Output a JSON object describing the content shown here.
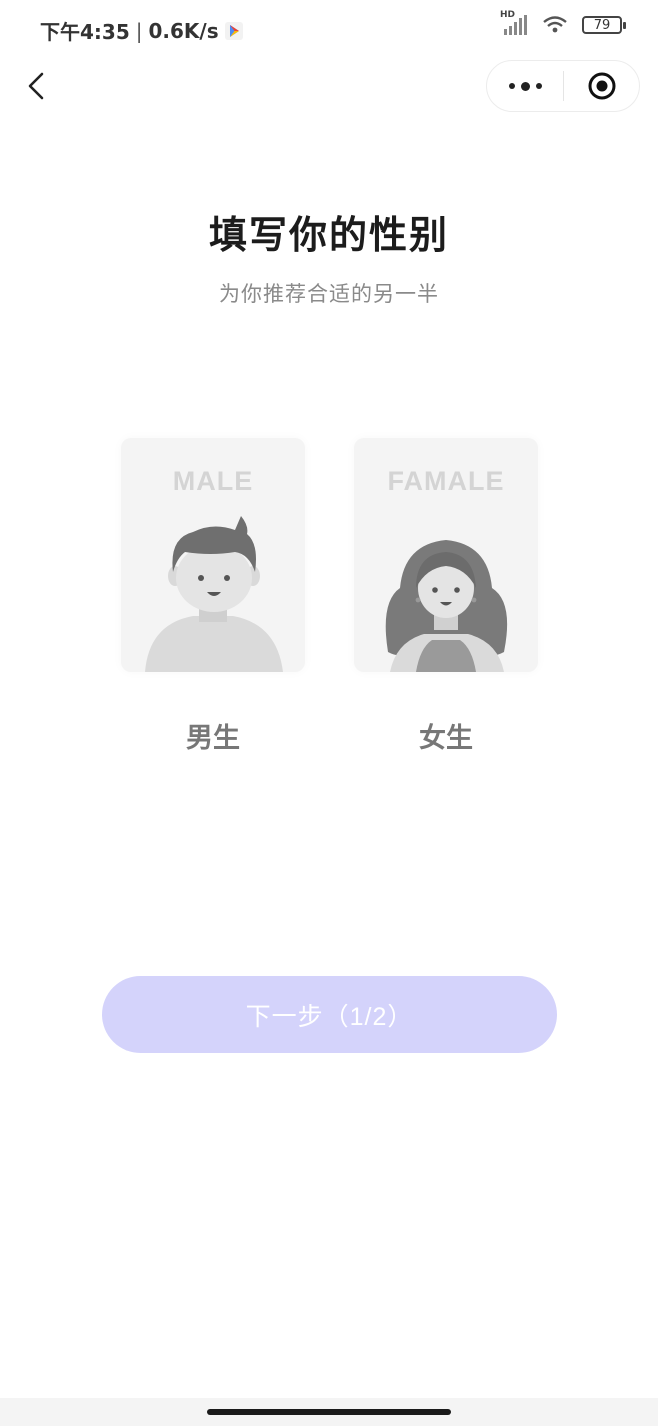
{
  "status_bar": {
    "time": "下午4:35",
    "separator": "|",
    "speed": "0.6K/s",
    "network": "HD",
    "battery": "79"
  },
  "page": {
    "title": "填写你的性别",
    "subtitle": "为你推荐合适的另一半"
  },
  "options": [
    {
      "caption": "MALE",
      "label": "男生"
    },
    {
      "caption": "FAMALE",
      "label": "女生"
    }
  ],
  "next_button": {
    "label": "下一步（1/2）"
  },
  "colors": {
    "button_bg": "#d4d3fb",
    "title": "#1c1c1c",
    "subtitle": "#8a8a8a",
    "card_bg": "#f4f4f4"
  },
  "icons": {
    "back": "chevron-left-icon",
    "more": "more-dots-icon",
    "close": "target-circle-icon",
    "play": "play-store-icon",
    "signal": "cellular-signal-icon",
    "wifi": "wifi-icon",
    "battery": "battery-icon"
  }
}
